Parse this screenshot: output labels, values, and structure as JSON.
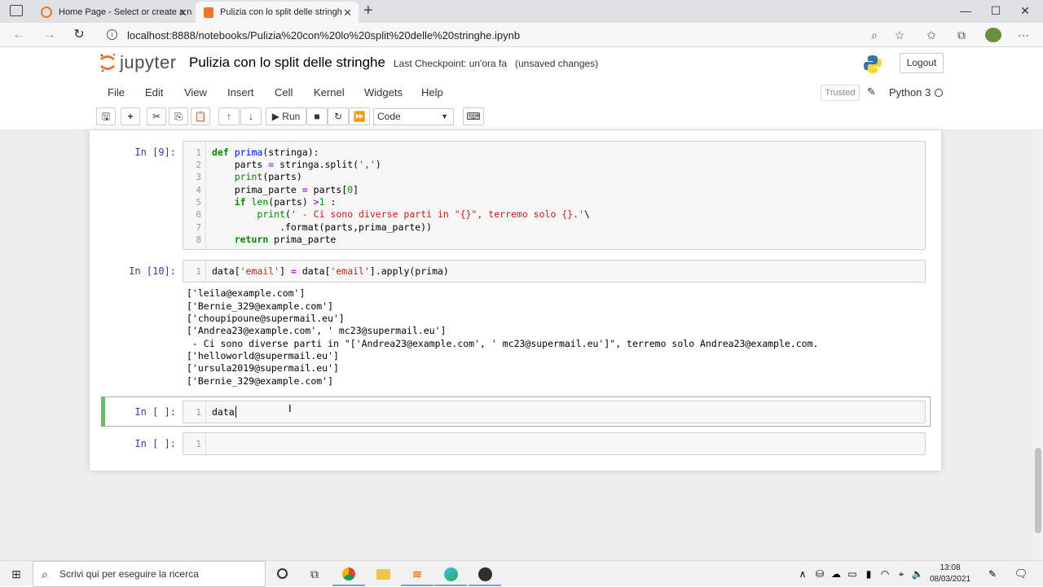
{
  "browser": {
    "tabs": [
      {
        "title": "Home Page - Select or create a n",
        "active": false
      },
      {
        "title": "Pulizia con lo split delle stringhe",
        "active": true
      }
    ],
    "new_tab": "+",
    "url": "localhost:8888/notebooks/Pulizia%20con%20lo%20split%20delle%20stringhe.ipynb"
  },
  "jupyter": {
    "logo_text": "jupyter",
    "notebook_title": "Pulizia con lo split delle stringhe",
    "checkpoint": "Last Checkpoint: un'ora fa",
    "unsaved": "(unsaved changes)",
    "logout": "Logout",
    "menu": [
      "File",
      "Edit",
      "View",
      "Insert",
      "Cell",
      "Kernel",
      "Widgets",
      "Help"
    ],
    "trusted": "Trusted",
    "kernel": "Python 3",
    "toolbar": {
      "run": "Run",
      "cell_type": "Code"
    }
  },
  "cells": [
    {
      "prompt": "In [9]:",
      "line_numbers": [
        "1",
        "2",
        "3",
        "4",
        "5",
        "6",
        "7",
        "8"
      ]
    },
    {
      "prompt": "In [10]:",
      "line_numbers": [
        "1"
      ],
      "output": [
        "['leila@example.com']",
        "['Bernie_329@example.com']",
        "['choupipoune@supermail.eu']",
        "['Andrea23@example.com', ' mc23@supermail.eu']",
        " - Ci sono diverse parti in \"['Andrea23@example.com', ' mc23@supermail.eu']\", terremo solo Andrea23@example.com.",
        "['helloworld@supermail.eu']",
        "['ursula2019@supermail.eu']",
        "['Bernie_329@example.com']"
      ]
    },
    {
      "prompt": "In [ ]:",
      "line_numbers": [
        "1"
      ],
      "code": "data"
    },
    {
      "prompt": "In [ ]:",
      "line_numbers": [
        "1"
      ],
      "code": ""
    }
  ],
  "taskbar": {
    "search_placeholder": "Scrivi qui per eseguire la ricerca",
    "time": "13:08",
    "date": "08/03/2021"
  }
}
